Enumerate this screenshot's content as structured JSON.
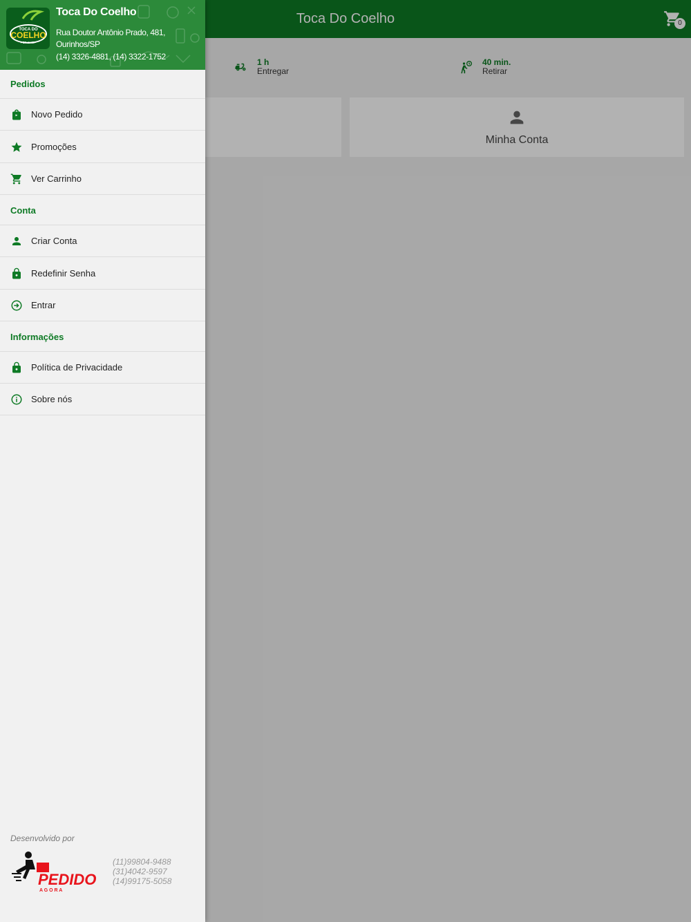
{
  "app": {
    "title": "Toca Do Coelho",
    "cart_count": "0",
    "delivery": {
      "time": "1 h",
      "label": "Entregar"
    },
    "pickup": {
      "time": "40 min.",
      "label": "Retirar"
    },
    "tiles": {
      "account_label": "Minha Conta"
    }
  },
  "drawer": {
    "store": {
      "name": "Toca Do Coelho",
      "address": "Rua Doutor Antônio Prado, 481, Ourinhos/SP",
      "phones": "(14) 3326-4881, (14) 3322-1752",
      "logo_text_top": "TOCA DO",
      "logo_text_main": "COELHO",
      "logo_text_sub": "PET SHOP"
    },
    "sections": {
      "orders": {
        "title": "Pedidos",
        "items": [
          {
            "label": "Novo Pedido",
            "icon": "shopping-bag-icon"
          },
          {
            "label": "Promoções",
            "icon": "star-icon"
          },
          {
            "label": "Ver Carrinho",
            "icon": "cart-icon"
          }
        ]
      },
      "account": {
        "title": "Conta",
        "items": [
          {
            "label": "Criar Conta",
            "icon": "person-icon"
          },
          {
            "label": "Redefinir Senha",
            "icon": "lock-icon"
          },
          {
            "label": "Entrar",
            "icon": "login-icon"
          }
        ]
      },
      "info": {
        "title": "Informações",
        "items": [
          {
            "label": "Política de Privacidade",
            "icon": "lock-icon"
          },
          {
            "label": "Sobre nós",
            "icon": "info-icon"
          }
        ]
      }
    },
    "footer": {
      "developed_by": "Desenvolvido por",
      "brand_main": "PEDIDO",
      "brand_sub": "A G O R A",
      "phones": [
        "(11)99804-9488",
        "(31)4042-9597",
        "(14)99175-5058"
      ]
    }
  },
  "colors": {
    "primary": "#0e7a25",
    "drawer_header": "#2c8a3a",
    "drawer_bg": "#f1f1f1",
    "brand_accent": "#e8141c"
  }
}
